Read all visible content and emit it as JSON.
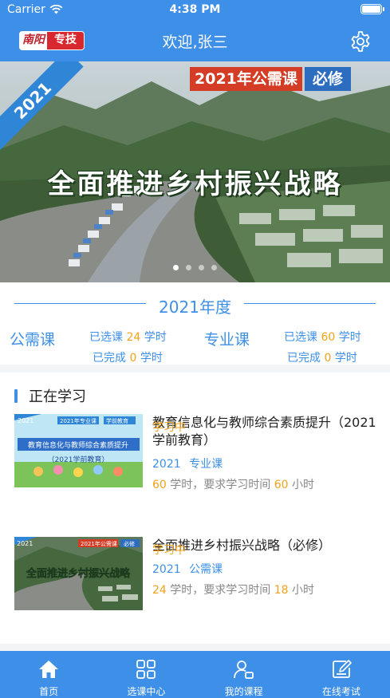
{
  "status_bar": {
    "carrier": "Carrier",
    "time": "4:38 PM"
  },
  "nav": {
    "logo_part1": "南阳",
    "logo_part2": "专技",
    "title": "欢迎,张三"
  },
  "banner": {
    "year_tag": "2021",
    "category_tag": "2021年公需课",
    "required_tag": "必修",
    "headline": "全面推进乡村振兴战略",
    "dots_total": 4,
    "dots_active": 0
  },
  "year_stats": {
    "year_title": "2021年度",
    "public": {
      "label": "公需课",
      "selected_prefix": "已选课",
      "selected_value": "24",
      "selected_unit": "学时",
      "done_prefix": "已完成",
      "done_value": "0",
      "done_unit": "学时"
    },
    "professional": {
      "label": "专业课",
      "selected_prefix": "已选课",
      "selected_value": "60",
      "selected_unit": "学时",
      "done_prefix": "已完成",
      "done_value": "0",
      "done_unit": "学时"
    }
  },
  "learning": {
    "section_title": "正在学习",
    "courses": [
      {
        "title": "教育信息化与教师综合素质提升（2021学前教育）",
        "year": "2021",
        "type": "专业课",
        "hours": "60",
        "hours_mid": "学时，要求学习时间",
        "required_hours": "60",
        "required_unit": "小时",
        "status": "学习中",
        "thumb": {
          "year": "2021",
          "tag1": "2021年专业课",
          "tag2": "学前教育",
          "line1": "教育信息化与教师综合素质提升",
          "line2": "（2021学前教育）"
        }
      },
      {
        "title": "全面推进乡村振兴战略（必修）",
        "year": "2021",
        "type": "公需课",
        "hours": "24",
        "hours_mid": "学时，要求学习时间",
        "required_hours": "18",
        "required_unit": "小时",
        "status": "学习中",
        "thumb": {
          "year": "2021",
          "tag1": "2021年公需课",
          "tag2": "必修",
          "line1": "全面推进乡村振兴战略"
        }
      }
    ]
  },
  "tabbar": {
    "tabs": [
      {
        "label": "首页",
        "icon": "home-icon",
        "active": true
      },
      {
        "label": "选课中心",
        "icon": "grid-icon",
        "active": false
      },
      {
        "label": "我的课程",
        "icon": "user-course-icon",
        "active": false
      },
      {
        "label": "在线考试",
        "icon": "exam-edit-icon",
        "active": false
      }
    ]
  },
  "colors": {
    "primary": "#3d8fe8",
    "accent": "#f2a31b",
    "banner_red": "#d43c25"
  }
}
